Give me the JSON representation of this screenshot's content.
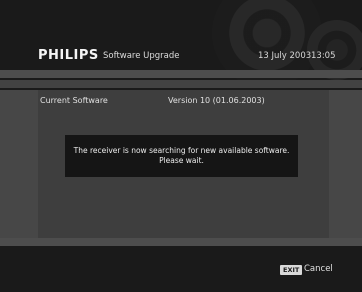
{
  "header": {
    "brand": "PHILIPS",
    "title": "Software Upgrade",
    "date": "13 July 2003",
    "time": "13:05"
  },
  "current_software": {
    "label": "Current Software",
    "value": "Version 10 (01.06.2003)"
  },
  "message": {
    "line1": "The receiver is now searching for new available software.",
    "line2": "Please wait."
  },
  "footer": {
    "exit_key": "EXIT",
    "exit_label": "Cancel"
  }
}
